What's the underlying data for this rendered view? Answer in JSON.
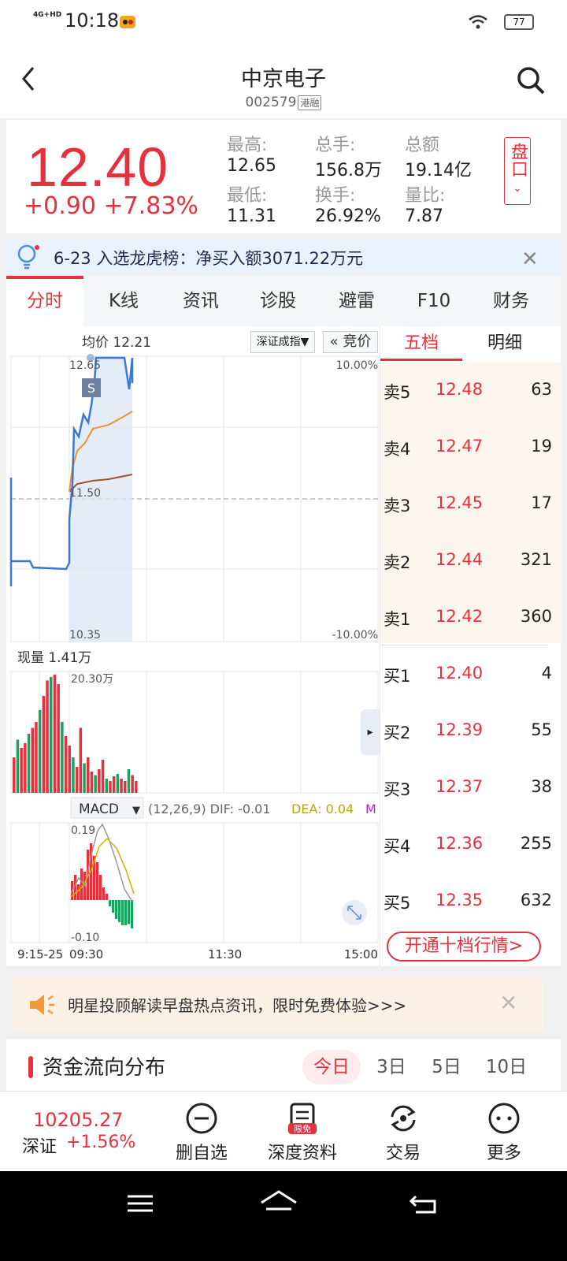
{
  "status": {
    "time": "10:18",
    "network": "4G+HD",
    "battery": "77"
  },
  "header": {
    "title": "中京电子",
    "code": "002579",
    "tag": "港融"
  },
  "quote": {
    "price": "12.40",
    "change": "+0.90  +7.83%",
    "stats": [
      {
        "k": "最高:",
        "v": "12.65"
      },
      {
        "k": "总手:",
        "v": "156.8万"
      },
      {
        "k": "总额",
        "v": "19.14亿"
      },
      {
        "k": "最低:",
        "v": "11.31"
      },
      {
        "k": "换手:",
        "v": "26.92%"
      },
      {
        "k": "量比:",
        "v": "7.87"
      }
    ],
    "pankou": "盘口"
  },
  "notice": {
    "text": "6-23 入选龙虎榜：净买入额3071.22万元"
  },
  "tabs": [
    "分时",
    "K线",
    "资讯",
    "诊股",
    "避雷",
    "F10",
    "财务"
  ],
  "chart": {
    "avg_label": "均价 12.21",
    "index_select": "深证成指▼",
    "auction": "« 竞价",
    "price_top": "12.65",
    "price_mid": "11.50",
    "price_bottom": "10.35",
    "pct_top": "10.00%",
    "pct_bottom": "-10.00%",
    "marker": "S",
    "volume_label": "现量 1.41万",
    "volume_max": "20.30万",
    "macd_select": "MACD",
    "macd_params": "(12,26,9) DIF: -0.01",
    "macd_dea": "DEA: 0.04",
    "macd_m": "M",
    "macd_top": "0.19",
    "macd_bottom": "-0.10",
    "time_labels": [
      "9:15-25",
      "09:30",
      "11:30",
      "15:00"
    ]
  },
  "orderbook": {
    "tabs": [
      "五档",
      "明细"
    ],
    "asks": [
      {
        "label": "卖5",
        "price": "12.48",
        "vol": "63"
      },
      {
        "label": "卖4",
        "price": "12.47",
        "vol": "19"
      },
      {
        "label": "卖3",
        "price": "12.45",
        "vol": "17"
      },
      {
        "label": "卖2",
        "price": "12.44",
        "vol": "321"
      },
      {
        "label": "卖1",
        "price": "12.42",
        "vol": "360"
      }
    ],
    "bids": [
      {
        "label": "买1",
        "price": "12.40",
        "vol": "4"
      },
      {
        "label": "买2",
        "price": "12.39",
        "vol": "55"
      },
      {
        "label": "买3",
        "price": "12.37",
        "vol": "38"
      },
      {
        "label": "买4",
        "price": "12.36",
        "vol": "255"
      },
      {
        "label": "买5",
        "price": "12.35",
        "vol": "632"
      }
    ],
    "upgrade": "开通十档行情>"
  },
  "promo": {
    "text": "明星投顾解读早盘热点资讯，限时免费体验>>>"
  },
  "fundflow": {
    "title": "资金流向分布",
    "tabs": [
      "今日",
      "3日",
      "5日",
      "10日"
    ]
  },
  "toolbar": {
    "index_value": "10205.27",
    "index_name": "深证",
    "index_change": "+1.56%",
    "buttons": [
      "删自选",
      "深度资料",
      "交易",
      "更多"
    ],
    "badge": "限免"
  },
  "colors": {
    "up": "#e5313e",
    "down": "#1aa35f",
    "price_line": "#3a78d8",
    "avg_line": "#f0922c"
  }
}
